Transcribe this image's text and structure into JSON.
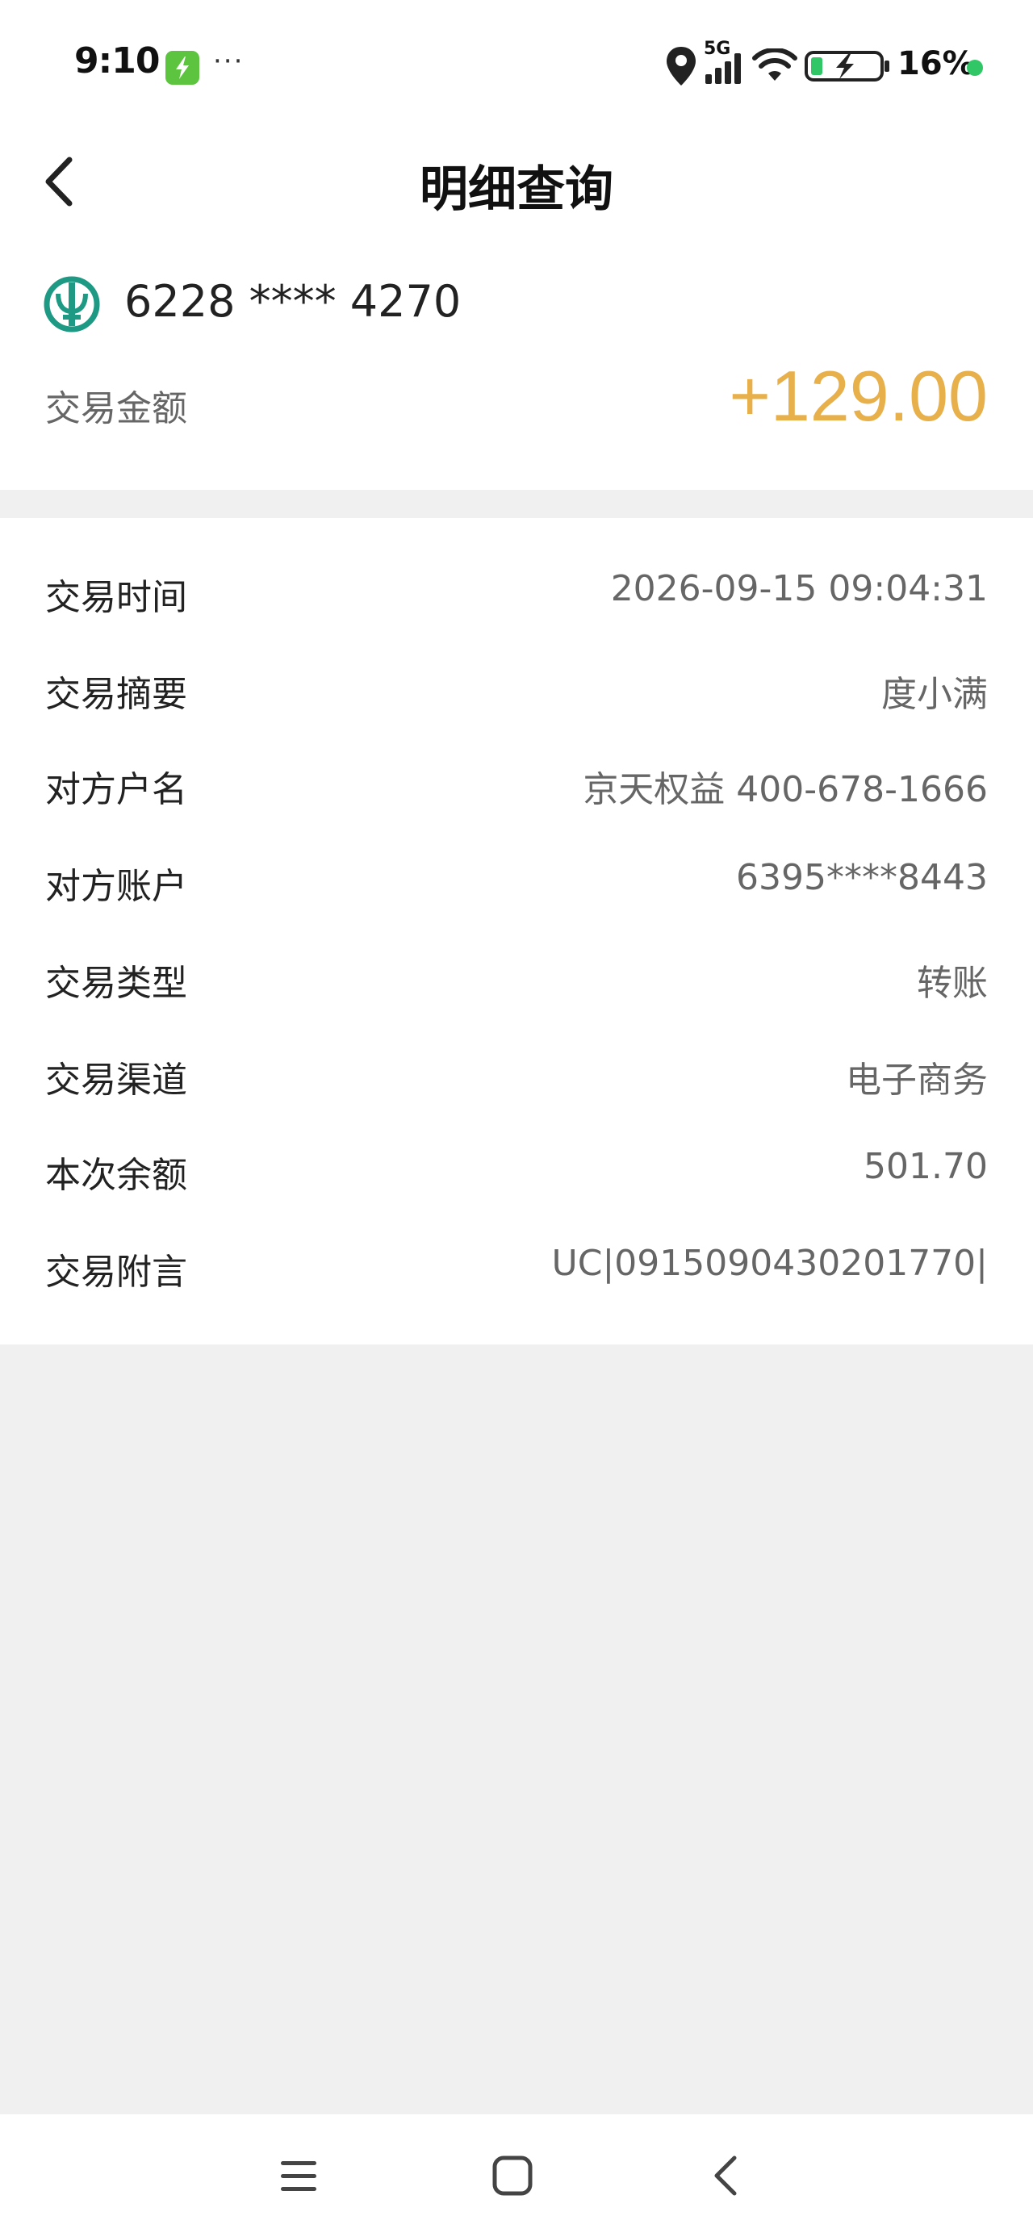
{
  "status_bar": {
    "time": "9:10",
    "more": "···",
    "network": "5G",
    "battery_percent": "16%",
    "icons": [
      "charging-app-icon",
      "location-icon",
      "cellular-signal-icon",
      "wifi-icon",
      "battery-charging-icon",
      "status-dot"
    ],
    "colors": {
      "app_badge": "#5cc43e",
      "status_dot": "#32c766"
    }
  },
  "header": {
    "title": "明细查询",
    "back_icon": "chevron-left-icon"
  },
  "summary": {
    "bank_logo_icon": "agricultural-bank-logo-icon",
    "card_number": "6228 **** 4270",
    "amount_label": "交易金额",
    "amount_value": "+129.00",
    "amount_color": "#e8b04a",
    "logo_color": "#1e9a84"
  },
  "details": [
    {
      "label": "交易时间",
      "value": "2026-09-15 09:04:31"
    },
    {
      "label": "交易摘要",
      "value": "度小满"
    },
    {
      "label": "对方户名",
      "value": "京天权益 400-678-1666"
    },
    {
      "label": "对方账户",
      "value": "6395****8443"
    },
    {
      "label": "交易类型",
      "value": "转账"
    },
    {
      "label": "交易渠道",
      "value": "电子商务"
    },
    {
      "label": "本次余额",
      "value": "501.70"
    },
    {
      "label": "交易附言",
      "value": "UC|0915090430201770|"
    }
  ],
  "nav_bar": {
    "icons": [
      "menu-icon",
      "home-icon",
      "back-icon"
    ]
  }
}
